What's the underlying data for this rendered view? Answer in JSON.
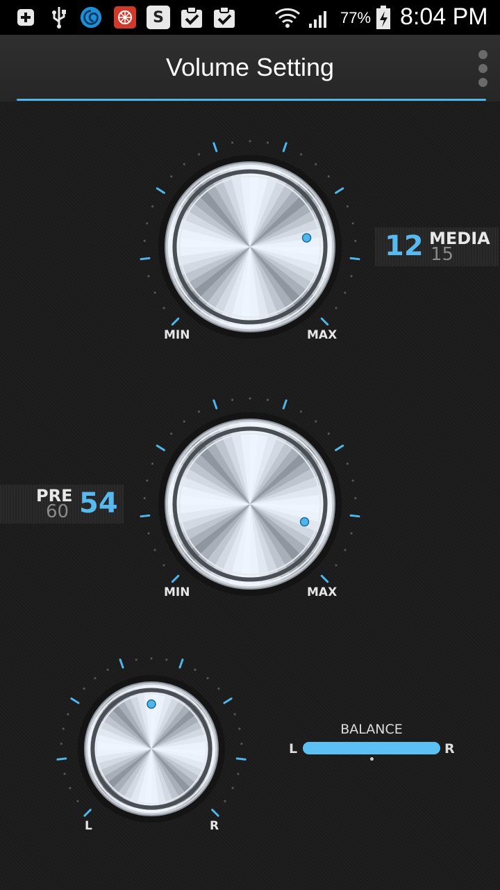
{
  "status_bar": {
    "battery_percent": "77%",
    "time": "8:04 PM",
    "icons": [
      "notification-add-icon",
      "usb-icon",
      "spiral-app-icon",
      "red-app-icon",
      "s-app-icon",
      "check-clipboard-icon",
      "check-clipboard-icon",
      "wifi-icon",
      "signal-icon",
      "battery-charging-icon"
    ]
  },
  "header": {
    "title": "Volume Setting"
  },
  "media": {
    "value": "12",
    "label": "MEDIA",
    "max": "15",
    "min_label": "MIN",
    "max_label": "MAX"
  },
  "pre": {
    "value": "54",
    "label": "PRE",
    "max": "60",
    "min_label": "MIN",
    "max_label": "MAX"
  },
  "balance": {
    "title": "BALANCE",
    "left_label": "L",
    "right_label": "R",
    "knob_left_label": "L",
    "knob_right_label": "R"
  },
  "colors": {
    "accent": "#4fb6ec",
    "background": "#1c1c1c"
  }
}
